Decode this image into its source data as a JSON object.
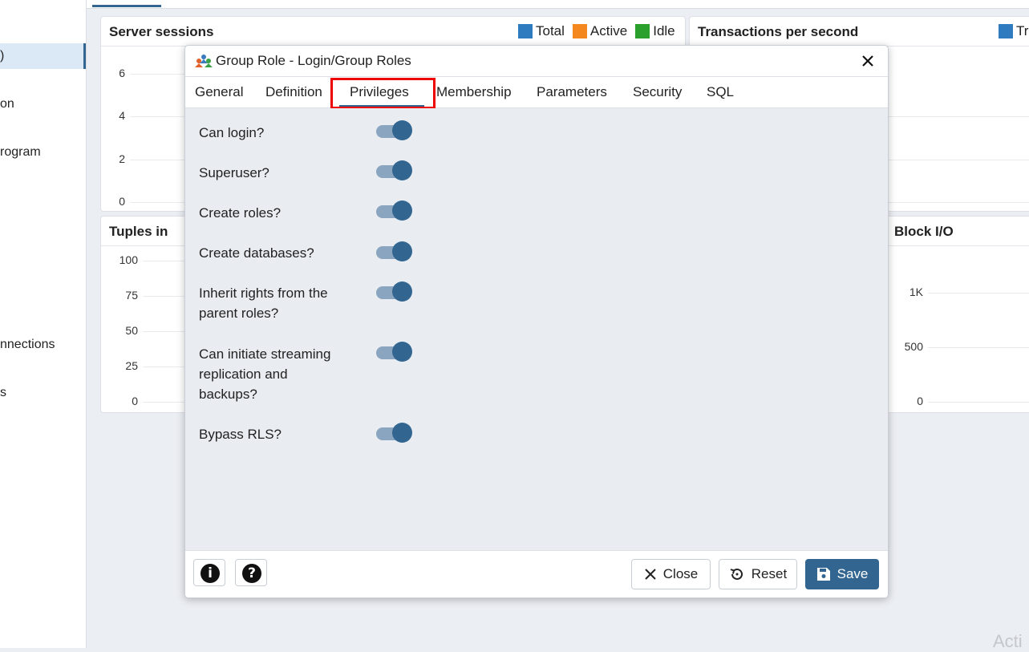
{
  "sidebar": {
    "items": [
      {
        "label": ")"
      },
      {
        "label": "on"
      },
      {
        "label": "rogram"
      },
      {
        "label": "nnections"
      },
      {
        "label": "s"
      }
    ]
  },
  "dashboard": {
    "server_sessions": {
      "title": "Server sessions",
      "legend": [
        {
          "label": "Total",
          "color": "#2e7bbf"
        },
        {
          "label": "Active",
          "color": "#f5871f"
        },
        {
          "label": "Idle",
          "color": "#2ca02c"
        }
      ],
      "yticks": [
        "6",
        "4",
        "2",
        "0"
      ]
    },
    "transactions": {
      "title": "Transactions per second",
      "legend": [
        {
          "label": "Tr",
          "color": "#2e7bbf"
        }
      ]
    },
    "tuples_in": {
      "title": "Tuples in",
      "yticks": [
        "100",
        "75",
        "50",
        "25",
        "0"
      ]
    },
    "block_io": {
      "title": "Block I/O",
      "yticks": [
        "1K",
        "500",
        "0"
      ]
    }
  },
  "modal": {
    "title": "Group Role - Login/Group Roles",
    "tabs": [
      "General",
      "Definition",
      "Privileges",
      "Membership",
      "Parameters",
      "Security",
      "SQL"
    ],
    "active_tab": "Privileges",
    "fields": [
      {
        "label": "Can login?",
        "on": true
      },
      {
        "label": "Superuser?",
        "on": true
      },
      {
        "label": "Create roles?",
        "on": true
      },
      {
        "label": "Create databases?",
        "on": true
      },
      {
        "label": "Inherit rights from the parent roles?",
        "on": true
      },
      {
        "label": "Can initiate streaming replication and backups?",
        "on": true
      },
      {
        "label": "Bypass RLS?",
        "on": true
      }
    ],
    "footer": {
      "info_icon": "i",
      "help_icon": "?",
      "close_label": "Close",
      "reset_label": "Reset",
      "save_label": "Save"
    }
  },
  "watermark": "Acti",
  "colors": {
    "accent": "#326690",
    "highlight": "#ee0000"
  }
}
